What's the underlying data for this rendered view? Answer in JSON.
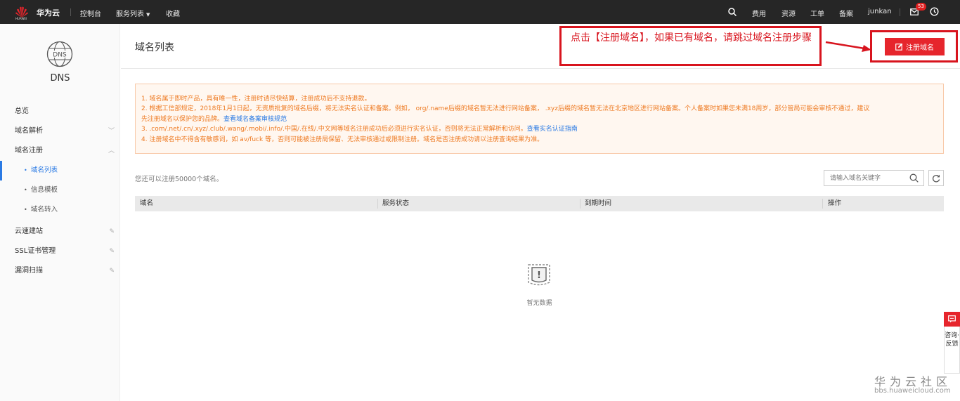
{
  "topbar": {
    "logo_sub": "HUAWEI",
    "brand": "华为云",
    "nav_console": "控制台",
    "nav_services": "服务列表",
    "nav_favorites": "收藏",
    "fees": "费用",
    "resources": "资源",
    "tickets": "工单",
    "filing": "备案",
    "username": "junkan",
    "mail_count": "53"
  },
  "sidebar": {
    "title": "DNS",
    "icon_text": "DNS",
    "items": [
      {
        "label": "总览"
      },
      {
        "label": "域名解析"
      },
      {
        "label": "域名注册"
      }
    ],
    "sub_items": [
      {
        "label": "域名列表"
      },
      {
        "label": "信息模板"
      },
      {
        "label": "域名转入"
      }
    ],
    "tools": [
      {
        "label": "云速建站"
      },
      {
        "label": "SSL证书管理"
      },
      {
        "label": "漏洞扫描"
      }
    ]
  },
  "main": {
    "title": "域名列表",
    "register_button": "注册域名",
    "annotation": "点击【注册域名】，如果已有域名，请跳过域名注册步骤",
    "notice": {
      "line1": "1. 域名属于即时产品，具有唯一性，注册时请尽快结算，注册成功后不支持退款。",
      "line2": "2. 根据工信部规定，2018年1月1日起，无资质批复的域名后缀，将无法实名认证和备案。例如， org/.name后缀的域名暂无法进行网站备案， .xyz后缀的域名暂无法在北京地区进行网站备案。个人备案时如果您未满18周岁，部分管局可能会审核不通过，建议",
      "line2b": "先注册域名以保护您的品牌。",
      "link2": "查看域名备案审核规范",
      "line3": "3. .com/.net/.cn/.xyz/.club/.wang/.mobi/.info/.中国/.在线/.中文网等域名注册成功后必须进行实名认证，否则将无法正常解析和访问。",
      "link3": "查看实名认证指南",
      "line4": "4. 注册域名中不得含有敏感词，如 av/fuck 等，否则可能被注册局保留、无法审核通过或限制注册。域名是否注册成功请以注册查询结果为准。"
    },
    "count_text": "您还可以注册50000个域名。",
    "search_placeholder": "请输入域名关键字",
    "columns": [
      "域名",
      "服务状态",
      "到期时间",
      "操作"
    ],
    "empty_text": "暂无数据"
  },
  "float": {
    "text": "咨询·反馈"
  },
  "watermark": {
    "title": "华为云社区",
    "url": "bbs.huaweicloud.com"
  },
  "colors": {
    "accent_red": "#e6252c",
    "link_blue": "#2a7ae4",
    "notice_orange": "#ee7a22"
  }
}
